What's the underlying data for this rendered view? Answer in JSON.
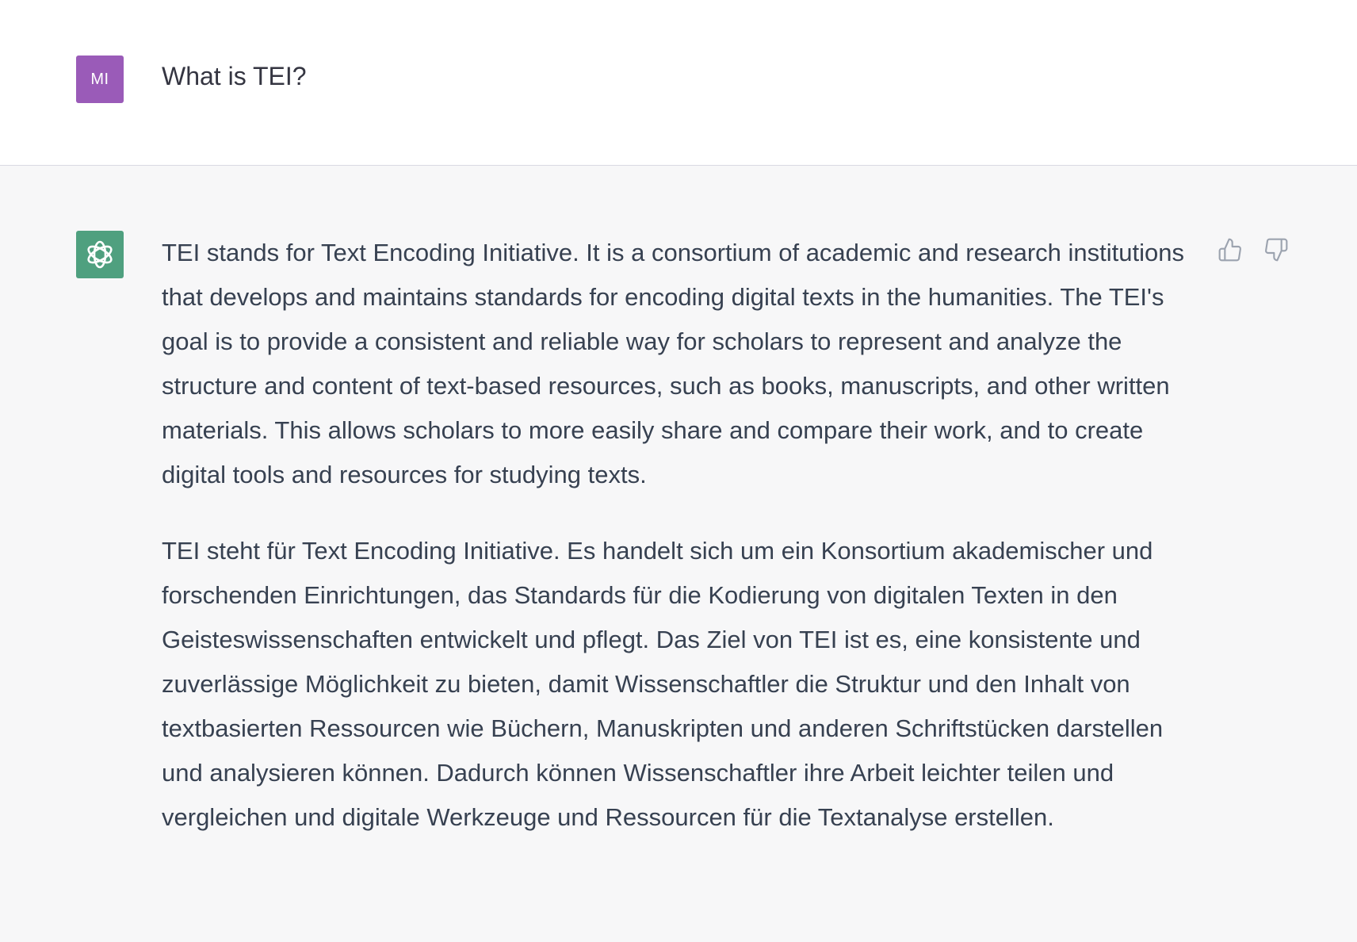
{
  "colors": {
    "user_avatar_bg": "#9a5bb8",
    "assistant_avatar_bg": "#4fa07f",
    "text": "#374151",
    "icon": "#9ca3af"
  },
  "user_message": {
    "avatar_initials": "MI",
    "text": "What is TEI?"
  },
  "assistant_message": {
    "avatar_icon": "openai-logo-icon",
    "paragraphs": [
      "TEI stands for Text Encoding Initiative. It is a consortium of academic and research institutions that develops and maintains standards for encoding digital texts in the humanities. The TEI's goal is to provide a consistent and reliable way for scholars to represent and analyze the structure and content of text-based resources, such as books, manuscripts, and other written materials. This allows scholars to more easily share and compare their work, and to create digital tools and resources for studying texts.",
      "TEI steht für Text Encoding Initiative. Es handelt sich um ein Konsortium akademischer und forschenden Einrichtungen, das Standards für die Kodierung von digitalen Texten in den Geisteswissenschaften entwickelt und pflegt. Das Ziel von TEI ist es, eine konsistente und zuverlässige Möglichkeit zu bieten, damit Wissenschaftler die Struktur und den Inhalt von textbasierten Ressourcen wie Büchern, Manuskripten und anderen Schriftstücken darstellen und analysieren können. Dadurch können Wissenschaftler ihre Arbeit leichter teilen und vergleichen und digitale Werkzeuge und Ressourcen für die Textanalyse erstellen."
    ],
    "feedback_icons": [
      "thumbs-up-icon",
      "thumbs-down-icon"
    ]
  }
}
